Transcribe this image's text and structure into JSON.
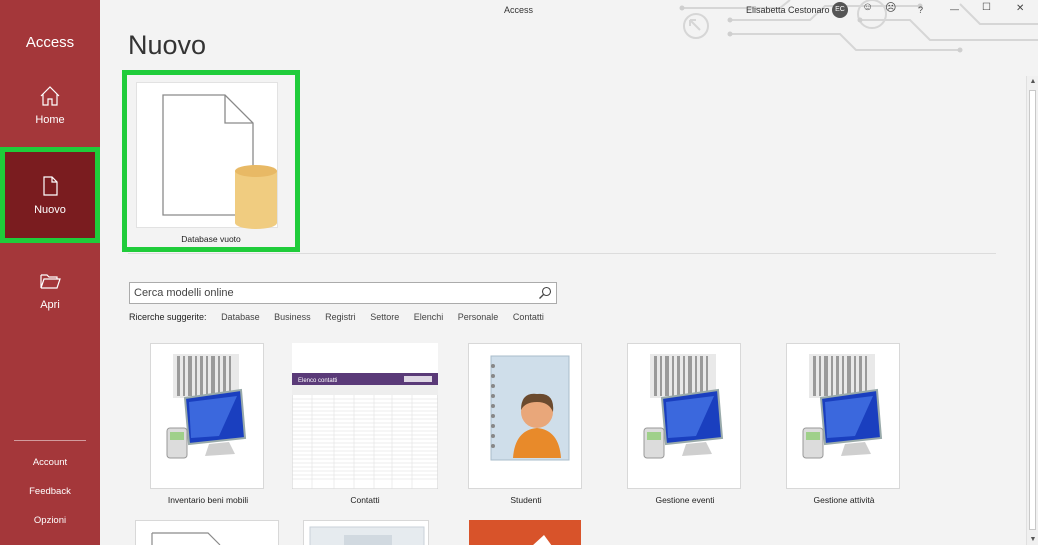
{
  "app": {
    "name": "Access",
    "title": "Access"
  },
  "user": {
    "name": "Elisabetta Cestonaro",
    "initials": "EC"
  },
  "window_controls": {
    "smile": "☺",
    "frown": "☹",
    "help": "?",
    "minimize": "—",
    "maximize": "☐",
    "close": "✕"
  },
  "sidebar": {
    "items": [
      {
        "label": "Home",
        "icon": "home-icon"
      },
      {
        "label": "Nuovo",
        "icon": "new-file-icon",
        "selected": true
      },
      {
        "label": "Apri",
        "icon": "folder-open-icon"
      }
    ],
    "links": [
      "Account",
      "Feedback",
      "Opzioni"
    ]
  },
  "page": {
    "title": "Nuovo"
  },
  "blank_template": {
    "label": "Database vuoto"
  },
  "search": {
    "placeholder": "Cerca modelli online",
    "value": ""
  },
  "suggested": {
    "label": "Ricerche suggerite:",
    "items": [
      "Database",
      "Business",
      "Registri",
      "Settore",
      "Elenchi",
      "Personale",
      "Contatti"
    ]
  },
  "templates": [
    {
      "name": "Inventario beni mobili",
      "icon": "computer-barcode-icon"
    },
    {
      "name": "Contatti",
      "icon": "contact-list-preview-icon"
    },
    {
      "name": "Studenti",
      "icon": "student-notebook-icon"
    },
    {
      "name": "Gestione eventi",
      "icon": "computer-barcode-icon"
    },
    {
      "name": "Gestione attività",
      "icon": "computer-barcode-icon"
    }
  ],
  "contacts_preview": {
    "title": "Elenco contatti"
  },
  "colors": {
    "sidebar": "#a4373a",
    "sidebar_selected": "#7a1c1f",
    "highlight": "#1fcc3a",
    "db_cylinder": "#f0cc80"
  }
}
